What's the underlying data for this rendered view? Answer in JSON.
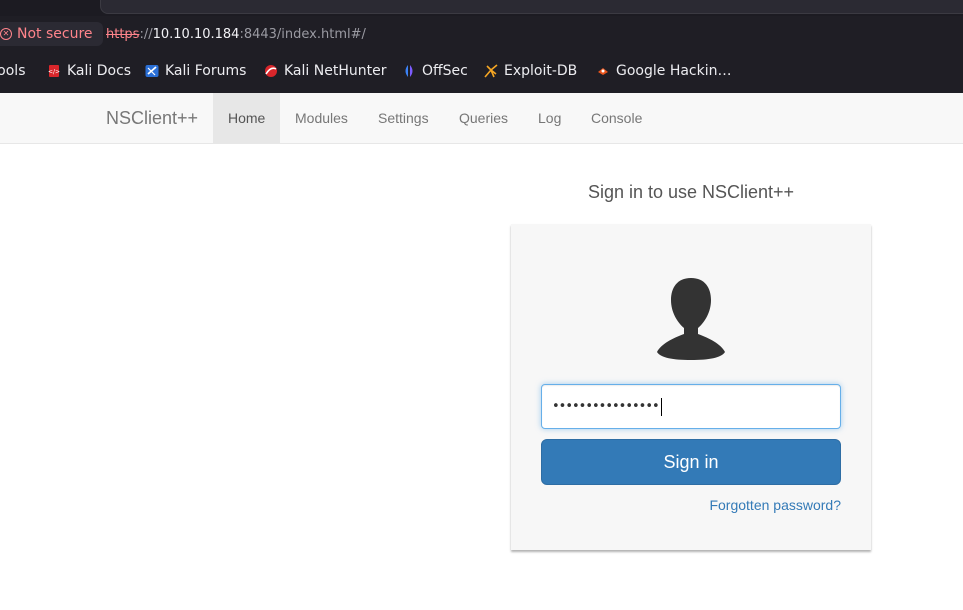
{
  "browser": {
    "security_label": "Not secure",
    "url": {
      "protocol": "https",
      "separator": "://",
      "host": "10.10.10.184",
      "rest": ":8443/index.html#/"
    },
    "bookmarks": [
      {
        "label": "Tools",
        "icon": "tools-icon"
      },
      {
        "label": "Kali Docs",
        "icon": "kali-docs-icon"
      },
      {
        "label": "Kali Forums",
        "icon": "kali-forums-icon"
      },
      {
        "label": "Kali NetHunter",
        "icon": "kali-nethunter-icon"
      },
      {
        "label": "OffSec",
        "icon": "offsec-icon"
      },
      {
        "label": "Exploit-DB",
        "icon": "exploit-db-icon"
      },
      {
        "label": "Google Hackin…",
        "icon": "google-hacking-icon"
      }
    ]
  },
  "navbar": {
    "brand": "NSClient++",
    "items": [
      {
        "label": "Home",
        "active": true
      },
      {
        "label": "Modules",
        "active": false
      },
      {
        "label": "Settings",
        "active": false
      },
      {
        "label": "Queries",
        "active": false
      },
      {
        "label": "Log",
        "active": false
      },
      {
        "label": "Console",
        "active": false
      }
    ]
  },
  "signin": {
    "heading": "Sign in to use NSClient++",
    "password_value": "••••••••••••••••",
    "button_label": "Sign in",
    "forgot_label": "Forgotten password?"
  },
  "colors": {
    "primary": "#337ab7",
    "insecure": "#ff848b",
    "nav_bg": "#f8f8f8",
    "chrome_bg": "#1f1e25"
  }
}
